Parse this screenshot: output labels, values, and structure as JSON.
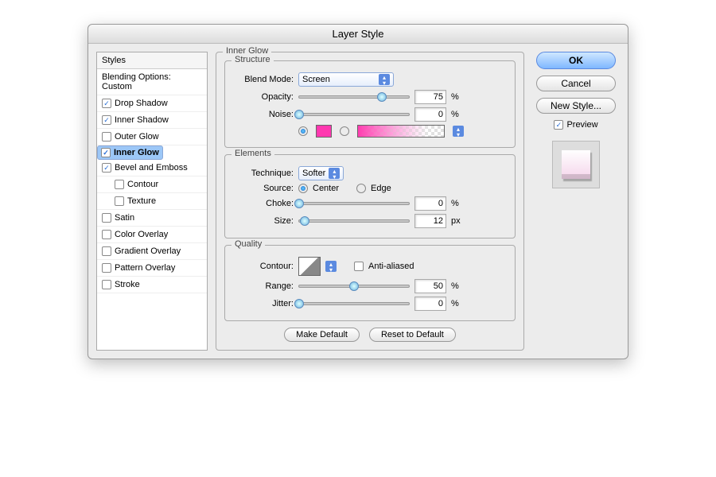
{
  "title": "Layer Style",
  "sidebar": {
    "header": "Styles",
    "blending": "Blending Options: Custom",
    "items": [
      {
        "label": "Drop Shadow",
        "checked": true
      },
      {
        "label": "Inner Shadow",
        "checked": true
      },
      {
        "label": "Outer Glow",
        "checked": false
      },
      {
        "label": "Inner Glow",
        "checked": true,
        "selected": true
      },
      {
        "label": "Bevel and Emboss",
        "checked": true
      },
      {
        "label": "Contour",
        "checked": false,
        "indent": true
      },
      {
        "label": "Texture",
        "checked": false,
        "indent": true
      },
      {
        "label": "Satin",
        "checked": false
      },
      {
        "label": "Color Overlay",
        "checked": false
      },
      {
        "label": "Gradient Overlay",
        "checked": false
      },
      {
        "label": "Pattern Overlay",
        "checked": false
      },
      {
        "label": "Stroke",
        "checked": false
      }
    ]
  },
  "panel_title": "Inner Glow",
  "structure": {
    "legend": "Structure",
    "blend_label": "Blend Mode:",
    "blend_value": "Screen",
    "opacity_label": "Opacity:",
    "opacity_value": "75",
    "noise_label": "Noise:",
    "noise_value": "0",
    "pct": "%",
    "color": "#ff38b0"
  },
  "elements": {
    "legend": "Elements",
    "technique_label": "Technique:",
    "technique_value": "Softer",
    "source_label": "Source:",
    "center": "Center",
    "edge": "Edge",
    "choke_label": "Choke:",
    "choke_value": "0",
    "size_label": "Size:",
    "size_value": "12",
    "pct": "%",
    "px": "px"
  },
  "quality": {
    "legend": "Quality",
    "contour_label": "Contour:",
    "aa_label": "Anti-aliased",
    "range_label": "Range:",
    "range_value": "50",
    "jitter_label": "Jitter:",
    "jitter_value": "0",
    "pct": "%"
  },
  "buttons": {
    "make_default": "Make Default",
    "reset": "Reset to Default",
    "ok": "OK",
    "cancel": "Cancel",
    "new_style": "New Style...",
    "preview": "Preview"
  }
}
